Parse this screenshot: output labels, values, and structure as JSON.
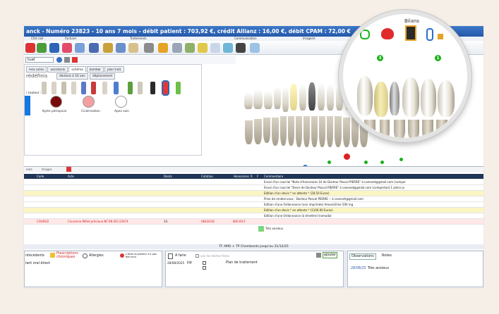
{
  "window": {
    "title": "anck - Numéro 23823 - 10 ans 7 mois - débit patient : 703,92 €, crédit Allianz : 16,00 €, débit CPAM : 72,00 €"
  },
  "menus": [
    "Cfat civil",
    "Facturer",
    "Traitements",
    "Communication",
    "Imagerie"
  ],
  "view_select": "tuel",
  "palette": {
    "tabs": [
      "mes actes",
      "assistants",
      "schéma",
      "bombar",
      "plan trait."
    ],
    "section_label": "rédéfinis",
    "subtabs": [
      "denture à 10 ans",
      "déplacement"
    ],
    "color_label": "i couleur :",
    "swatches": [
      {
        "label": "Kyste périapical",
        "color": "#7a0a0a"
      },
      {
        "label": "Cicatrisation",
        "color": "#f4a0a0"
      },
      {
        "label": "Apex sain",
        "color": "#ffffff"
      }
    ]
  },
  "records": {
    "tabs": [
      "ents",
      "Images"
    ],
    "columns": [
      "Code",
      "Acte",
      "Dents",
      "Cotation",
      "Honoraires",
      "R",
      "F",
      "Commentaire"
    ],
    "rows": [
      {
        "code": "",
        "acte": "",
        "dents": "",
        "cotation": "",
        "honoraires": "",
        "comment": "Envoi d'un courriel \"Note d'honoraires 10 de Docteur Pascal PIERRE\" à canevet@gmail.com (compor",
        "style": ""
      },
      {
        "code": "",
        "acte": "",
        "dents": "",
        "cotation": "",
        "honoraires": "",
        "comment": "Envoi d'un courriel \"Devis de Docteur Pascal PIERRE\" à canevet@gmail.com (comportant 1 pièce jo",
        "style": ""
      },
      {
        "code": "",
        "acte": "",
        "dents": "",
        "cotation": "",
        "honoraires": "",
        "comment": "Edition d'un devis * en attente * (28.50 Euros)",
        "style": "yellow"
      },
      {
        "code": "",
        "acte": "",
        "dents": "",
        "cotation": "",
        "honoraires": "",
        "comment": "Prise de rendez-vous - Docteur Pascal PIERRE -- à canevet@gmail.com",
        "style": ""
      },
      {
        "code": "",
        "acte": "",
        "dents": "",
        "cotation": "",
        "honoraires": "",
        "comment": "Edition d'une Ordonnance (non imprimée) Amoxicilline 500 mg",
        "style": ""
      },
      {
        "code": "",
        "acte": "",
        "dents": "",
        "cotation": "",
        "honoraires": "",
        "comment": "Edition d'un devis * en attente * (1100.00 Euros)",
        "style": "yellow"
      },
      {
        "code": "",
        "acte": "",
        "dents": "",
        "cotation": "",
        "honoraires": "",
        "comment": "Edition d'une Ordonnance (à émettre) tramadol",
        "style": ""
      },
      {
        "code": "COURO2",
        "acte": "Couronne Métal précieux NF EN ISO 22674",
        "dents": "14",
        "cotation": "HBLD318",
        "honoraires": "800.00 €",
        "comment": "",
        "style": "red"
      }
    ],
    "note": "Très anxieux"
  },
  "stats": "TF AMO + TP Chombonts jusqu'au 31/12/25",
  "bottom": {
    "antecedents": "ntécédents",
    "prescriptions": "Prescriptions chroniques",
    "allergies": "Allergies",
    "state_note": "L'état du patient n'a pas été revu",
    "oral_label": "lant oral direct",
    "todo_title": "A faire",
    "todo_filter": "voir les tâches finies",
    "todo_date": "28/08/2025",
    "todo_user": "jsp",
    "todo_item": "Plan de traitement",
    "add_button": "ajouter",
    "obs_tabs": [
      "Observations",
      "Notes"
    ],
    "obs_date": "28/08/25",
    "obs_text": "Très anxieux"
  },
  "magnifier": {
    "title": "Bilans",
    "badge1": "3",
    "badge2": "1"
  },
  "colors": {
    "title_bar": "#2f64b7",
    "table_header": "#1f3556",
    "caries_red": "#e02020",
    "blue_marker": "#2a6fd0",
    "green_badge": "#1ab21a"
  }
}
